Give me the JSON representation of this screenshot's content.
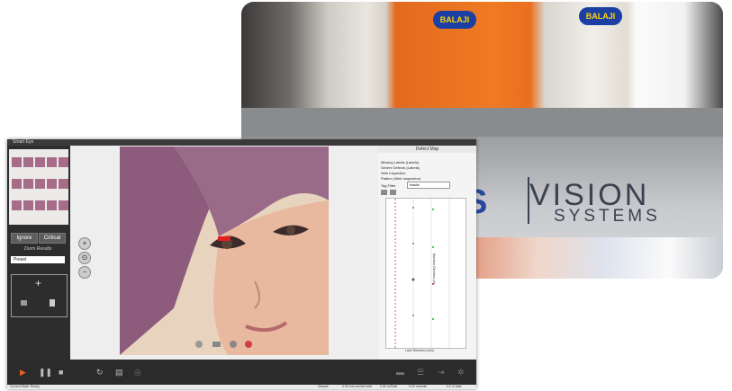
{
  "photo": {
    "badge_text": "BALAJI",
    "brand_line1": "VISION",
    "brand_line2": "SYSTEMS",
    "brand_logo_tail": "S",
    "brand_reg": "®"
  },
  "app": {
    "title": "Smart Eye",
    "buttons": {
      "ignore": "Ignore",
      "critical": "Critical"
    },
    "zoom_label": "Zoom Results",
    "preset": "Preset",
    "add": "+",
    "right_panel": {
      "title": "Defect Map",
      "checks": [
        "Missing Labels (Labels)",
        "Severe Defects (Labels)",
        "Web Inspection",
        "Pattern (Web Inspection)"
      ],
      "tag_filter": "Tag Filter",
      "tag_value": "Inside",
      "axis_bottom": "Lane Direction (mm)",
      "axis_side": "Machine Direction (m)"
    },
    "status": [
      "Current State: Ready",
      "Sample",
      "0.00 mm current web",
      "0.00 m/Total",
      "0.00 mm/min",
      "0.0 m total"
    ]
  }
}
